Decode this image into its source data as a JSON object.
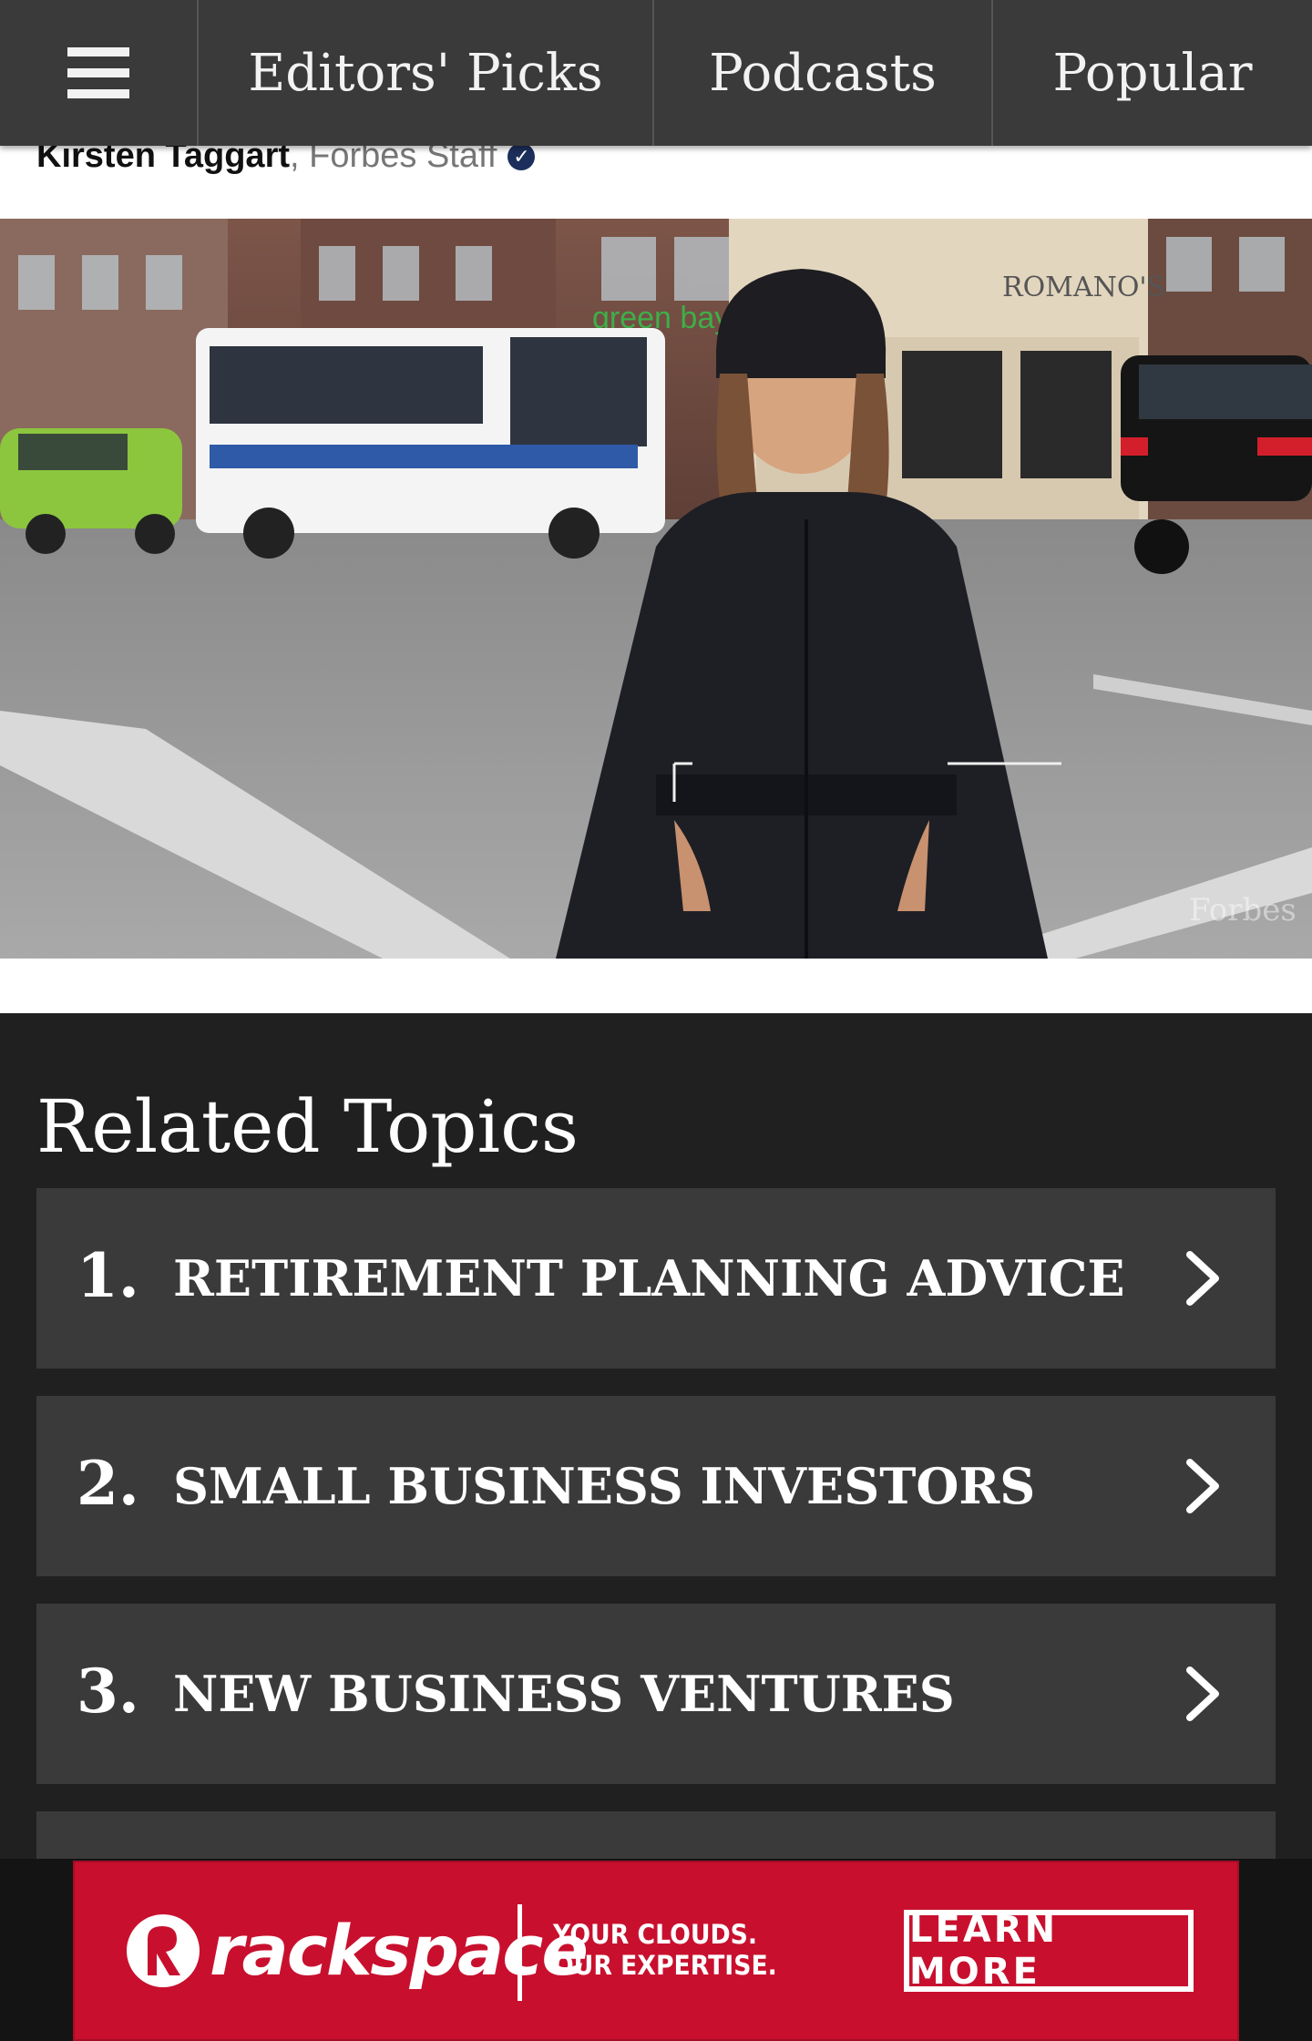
{
  "nav": {
    "menu_icon": "hamburger-menu-icon",
    "items": [
      "Editors' Picks",
      "Podcasts",
      "Popular"
    ]
  },
  "byline": {
    "author": "Kirsten Taggart",
    "role": ", Forbes Staff",
    "verified_icon": "verified-check-icon"
  },
  "video": {
    "storefront_sign": "ROMANO'S",
    "shop_sign": "green bay",
    "watermark": "Forbes"
  },
  "related": {
    "title": "Related Topics",
    "items": [
      {
        "num": "1.",
        "label": "RETIREMENT PLANNING ADVICE"
      },
      {
        "num": "2.",
        "label": "SMALL BUSINESS INVESTORS"
      },
      {
        "num": "3.",
        "label": "NEW BUSINESS VENTURES"
      }
    ],
    "arrow_icon": "chevron-right-icon"
  },
  "ad": {
    "brand": "rackspace",
    "tagline_line1": "YOUR CLOUDS.",
    "tagline_line2": "OUR EXPERTISE.",
    "cta": "LEARN MORE"
  },
  "colors": {
    "nav_bg": "#3a3a3a",
    "page_bg": "#202020",
    "topic_bg": "#3a3a3a",
    "ad_red": "#c8102e"
  }
}
